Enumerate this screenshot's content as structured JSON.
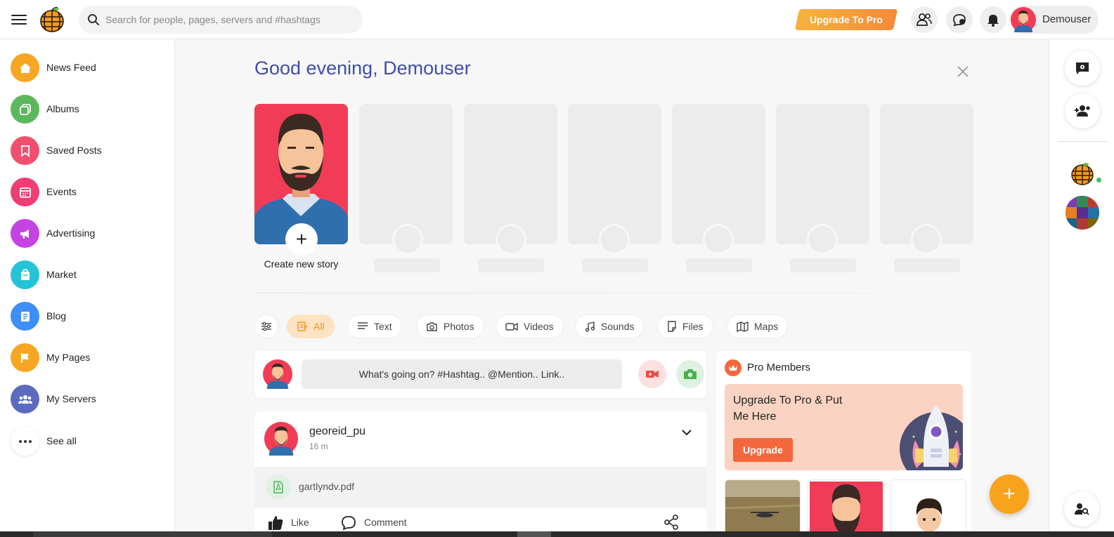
{
  "header": {
    "search_placeholder": "Search for people, pages, servers and #hashtags",
    "upgrade_label": "Upgrade To Pro",
    "user_name": "Demouser"
  },
  "sidebar": {
    "items": [
      {
        "label": "News Feed",
        "icon": "home-icon",
        "color": "#f7a624"
      },
      {
        "label": "Albums",
        "icon": "albums-icon",
        "color": "#5cb85c"
      },
      {
        "label": "Saved Posts",
        "icon": "bookmark-icon",
        "color": "#f0506e"
      },
      {
        "label": "Events",
        "icon": "calendar-icon",
        "color": "#ee3e74"
      },
      {
        "label": "Advertising",
        "icon": "megaphone-icon",
        "color": "#c443e2"
      },
      {
        "label": "Market",
        "icon": "shopping-bag-icon",
        "color": "#24c4d6"
      },
      {
        "label": "Blog",
        "icon": "blog-icon",
        "color": "#3e8ef7"
      },
      {
        "label": "My Pages",
        "icon": "flag-icon",
        "color": "#f7a624"
      },
      {
        "label": "My Servers",
        "icon": "group-icon",
        "color": "#5c6bc0"
      },
      {
        "label": "See all",
        "icon": "more-horizontal-icon",
        "color": "#ffffff"
      }
    ]
  },
  "greeting": "Good evening, Demouser",
  "stories": {
    "create_label": "Create new story"
  },
  "filters": [
    {
      "label": "All",
      "icon": "all-posts-icon",
      "active": true
    },
    {
      "label": "Text",
      "icon": "text-icon",
      "active": false
    },
    {
      "label": "Photos",
      "icon": "camera-icon",
      "active": false
    },
    {
      "label": "Videos",
      "icon": "video-icon",
      "active": false
    },
    {
      "label": "Sounds",
      "icon": "music-icon",
      "active": false
    },
    {
      "label": "Files",
      "icon": "file-icon",
      "active": false
    },
    {
      "label": "Maps",
      "icon": "map-icon",
      "active": false
    }
  ],
  "composer": {
    "placeholder": "What's going on? #Hashtag.. @Mention.. Link.."
  },
  "post": {
    "username": "georeid_pu",
    "time": "16 m",
    "file_name": "gartlyndv.pdf",
    "like_label": "Like",
    "comment_label": "Comment"
  },
  "pro_members": {
    "title": "Pro Members",
    "promo_text": "Upgrade To Pro & Put Me Here",
    "upgrade_button": "Upgrade"
  },
  "colors": {
    "accent": "#f9a21b",
    "greeting": "#3f4fa8",
    "promo_bg": "#fbd3c3",
    "promo_button": "#f4673c"
  }
}
